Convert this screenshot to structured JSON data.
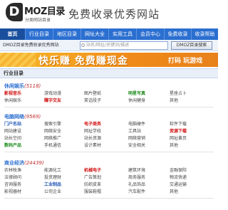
{
  "header": {
    "logo_letter": "D",
    "logo_name": "MOZ目录",
    "logo_sub": "分类网站目录",
    "slogan": "免费收录优秀网站"
  },
  "nav": [
    "首页",
    "行业目录",
    "地区目录",
    "网址大全",
    "实用工具",
    "会员中心",
    "免费收录",
    "收录帮助"
  ],
  "subbar": {
    "text": "DMOZ目录免费收录优秀网站",
    "search_placeholder": "站名/网址/关键词/描述",
    "search_button": "DMOZ目录搜索"
  },
  "banner": {
    "main": "快乐赚 免费赚现金",
    "side": "打码 玩游戏"
  },
  "category_heading": "行业目录",
  "sections": [
    {
      "title": "休闲娱乐",
      "count": "(5118)",
      "links": [
        [
          {
            "t": "影视音乐",
            "c": "red"
          },
          {
            "t": "游戏动漫",
            "c": ""
          },
          {
            "t": "图片壁纸",
            "c": ""
          },
          {
            "t": "明星写真",
            "c": "green"
          },
          {
            "t": "星座占卜",
            "c": ""
          }
        ],
        [
          {
            "t": "休闲娱乐",
            "c": ""
          },
          {
            "t": "赚字交友",
            "c": "red"
          },
          {
            "t": "笑话段子",
            "c": ""
          },
          {
            "t": "休闲健身",
            "c": ""
          },
          {
            "t": "其他",
            "c": ""
          }
        ]
      ]
    },
    {
      "title": "电脑网络",
      "count": "(9569)",
      "links": [
        [
          {
            "t": "门户名站",
            "c": "blue"
          },
          {
            "t": "搜索引擎",
            "c": ""
          },
          {
            "t": "电子商务",
            "c": "red"
          },
          {
            "t": "电脑硬件",
            "c": ""
          },
          {
            "t": "软件下载",
            "c": ""
          }
        ],
        [
          {
            "t": "网站建设",
            "c": ""
          },
          {
            "t": "网络安全",
            "c": ""
          },
          {
            "t": "网址学校",
            "c": ""
          },
          {
            "t": "工具站",
            "c": ""
          },
          {
            "t": "资源下载",
            "c": "red"
          }
        ],
        [
          {
            "t": "站长空间",
            "c": ""
          },
          {
            "t": "网络推广",
            "c": ""
          },
          {
            "t": "站长资源",
            "c": ""
          },
          {
            "t": "网络营销",
            "c": ""
          },
          {
            "t": "网址黄页",
            "c": ""
          }
        ],
        [
          {
            "t": "数码产品",
            "c": "green"
          },
          {
            "t": "手机通信",
            "c": ""
          },
          {
            "t": "设计素材",
            "c": ""
          },
          {
            "t": "安全相关",
            "c": ""
          },
          {
            "t": "其他",
            "c": ""
          }
        ]
      ]
    },
    {
      "title": "商业经济",
      "count": "(24439)",
      "links": [
        [
          {
            "t": "农林牧渔",
            "c": ""
          },
          {
            "t": "能源化工",
            "c": ""
          },
          {
            "t": "机械电子",
            "c": "red"
          },
          {
            "t": "建筑环境",
            "c": ""
          },
          {
            "t": "金融保险",
            "c": ""
          }
        ],
        [
          {
            "t": "法律顾问",
            "c": ""
          },
          {
            "t": "投资理财",
            "c": ""
          },
          {
            "t": "广告策划",
            "c": ""
          },
          {
            "t": "商务服务",
            "c": ""
          },
          {
            "t": "物流快递",
            "c": ""
          }
        ],
        [
          {
            "t": "咨询服务",
            "c": ""
          },
          {
            "t": "工业制品",
            "c": "blue"
          },
          {
            "t": "纺织皮革",
            "c": ""
          },
          {
            "t": "礼品饰品",
            "c": ""
          },
          {
            "t": "交通运输",
            "c": ""
          }
        ],
        [
          {
            "t": "影视器材",
            "c": ""
          },
          {
            "t": "公司企业",
            "c": ""
          },
          {
            "t": "服装鞋帽",
            "c": ""
          },
          {
            "t": "汽车配件",
            "c": ""
          },
          {
            "t": "其他",
            "c": ""
          }
        ]
      ]
    }
  ]
}
